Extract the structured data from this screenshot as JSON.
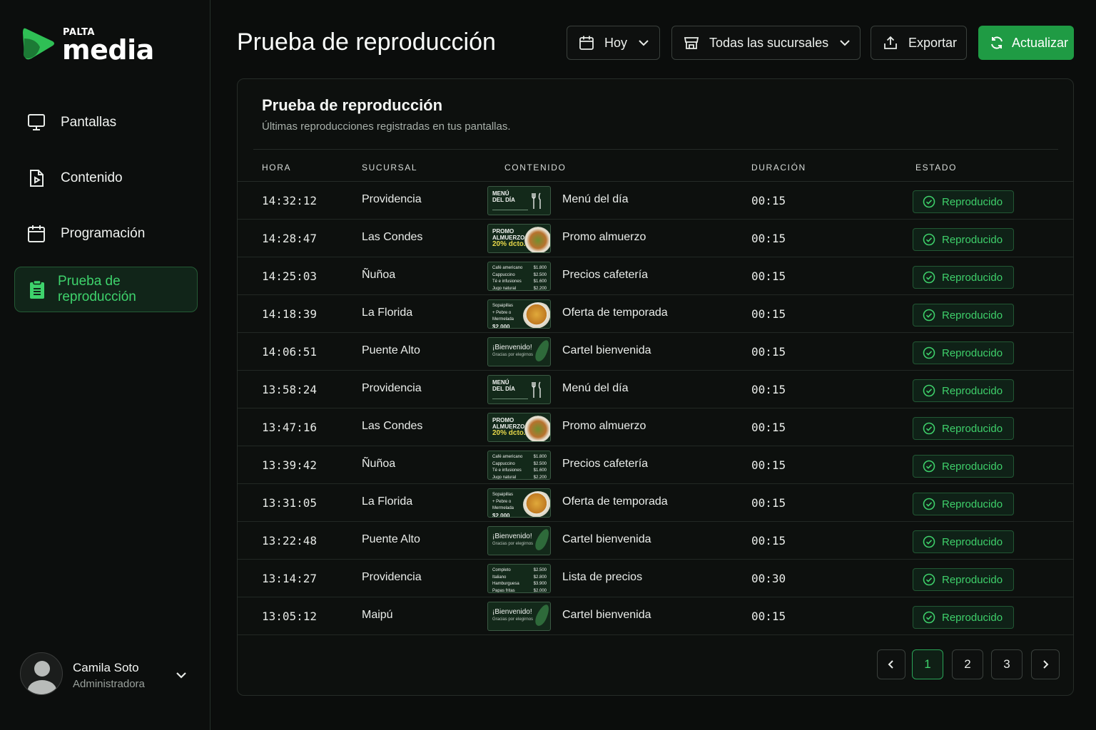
{
  "brand": {
    "small": "PALTA",
    "big": "media",
    "accent": "#3ed36c"
  },
  "sidebar": {
    "items": [
      {
        "label": "Pantallas",
        "icon": "monitor-icon"
      },
      {
        "label": "Contenido",
        "icon": "file-play-icon"
      },
      {
        "label": "Programación",
        "icon": "calendar-icon"
      },
      {
        "label": "Prueba de reproducción",
        "icon": "clipboard-icon",
        "active": true
      }
    ],
    "user": {
      "name": "Camila Soto",
      "role": "Administradora"
    }
  },
  "header": {
    "title": "Prueba de reproducción",
    "date_filter": "Hoy",
    "branch_filter": "Todas las sucursales",
    "export_label": "Exportar",
    "refresh_label": "Actualizar"
  },
  "card": {
    "title": "Prueba de reproducción",
    "subtitle": "Últimas reproducciones registradas en tus pantallas.",
    "columns": [
      "HORA",
      "SUCURSAL",
      "CONTENIDO",
      "DURACIÓN",
      "ESTADO"
    ],
    "rows": [
      {
        "time": "14:32:12",
        "branch": "Providencia",
        "thumb": "menu",
        "content": "Menú del día",
        "duration": "00:15",
        "status": "Reproducido"
      },
      {
        "time": "14:28:47",
        "branch": "Las Condes",
        "thumb": "promo",
        "content": "Promo almuerzo",
        "duration": "00:15",
        "status": "Reproducido"
      },
      {
        "time": "14:25:03",
        "branch": "Ñuñoa",
        "thumb": "cafe",
        "content": "Precios cafetería",
        "duration": "00:15",
        "status": "Reproducido"
      },
      {
        "time": "14:18:39",
        "branch": "La Florida",
        "thumb": "oferta",
        "content": "Oferta de temporada",
        "duration": "00:15",
        "status": "Reproducido"
      },
      {
        "time": "14:06:51",
        "branch": "Puente Alto",
        "thumb": "bienvenida",
        "content": "Cartel bienvenida",
        "duration": "00:15",
        "status": "Reproducido"
      },
      {
        "time": "13:58:24",
        "branch": "Providencia",
        "thumb": "menu",
        "content": "Menú del día",
        "duration": "00:15",
        "status": "Reproducido"
      },
      {
        "time": "13:47:16",
        "branch": "Las Condes",
        "thumb": "promo",
        "content": "Promo almuerzo",
        "duration": "00:15",
        "status": "Reproducido"
      },
      {
        "time": "13:39:42",
        "branch": "Ñuñoa",
        "thumb": "cafe",
        "content": "Precios cafetería",
        "duration": "00:15",
        "status": "Reproducido"
      },
      {
        "time": "13:31:05",
        "branch": "La Florida",
        "thumb": "oferta",
        "content": "Oferta de temporada",
        "duration": "00:15",
        "status": "Reproducido"
      },
      {
        "time": "13:22:48",
        "branch": "Puente Alto",
        "thumb": "bienvenida",
        "content": "Cartel bienvenida",
        "duration": "00:15",
        "status": "Reproducido"
      },
      {
        "time": "13:14:27",
        "branch": "Providencia",
        "thumb": "lista",
        "content": "Lista de precios",
        "duration": "00:30",
        "status": "Reproducido"
      },
      {
        "time": "13:05:12",
        "branch": "Maipú",
        "thumb": "bienvenida",
        "content": "Cartel bienvenida",
        "duration": "00:15",
        "status": "Reproducido"
      }
    ],
    "thumbs": {
      "menu": {
        "lines": [
          "MENÚ",
          "DEL DÍA"
        ]
      },
      "promo": {
        "lines": [
          "PROMO",
          "ALMUERZO",
          "20% dcto."
        ]
      },
      "cafe": {
        "items": [
          "Café americano",
          "Cappuccino",
          "Té e infusiones",
          "Jugo natural"
        ],
        "prices": [
          "$1.800",
          "$2.500",
          "$1.600",
          "$2.200"
        ]
      },
      "oferta": {
        "lines": [
          "Sopaipillas",
          "+ Pebre o",
          "Mermelada",
          "$2.000"
        ]
      },
      "bienvenida": {
        "lines": [
          "¡Bienvenido!",
          "Gracias por elegirnos"
        ]
      },
      "lista": {
        "items": [
          "Completo",
          "Italiano",
          "Hamburguesa",
          "Papas fritas"
        ],
        "prices": [
          "$2.500",
          "$2.800",
          "$3.900",
          "$2.000"
        ]
      }
    },
    "pagination": {
      "pages": [
        "1",
        "2",
        "3"
      ],
      "current": "1"
    }
  }
}
